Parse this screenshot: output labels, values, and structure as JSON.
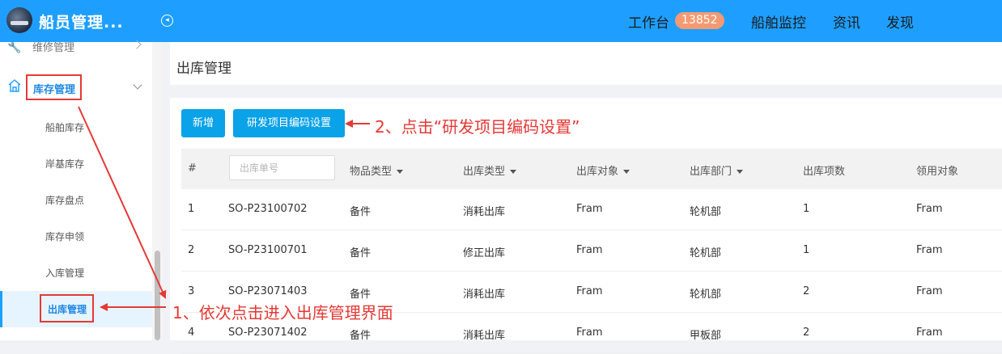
{
  "header": {
    "app_title": "船员管理...",
    "nav": {
      "workbench": "工作台",
      "workbench_badge": "13852",
      "ship_monitor": "船舶监控",
      "news": "资讯",
      "discover": "发现"
    },
    "colors": {
      "header_bg": "#1e9fff",
      "badge_bg": "#f49a72"
    }
  },
  "sidebar": {
    "items": [
      {
        "label": "维修管理",
        "icon": "wrench-icon"
      },
      {
        "label": "库存管理",
        "icon": "home-icon",
        "expanded": true
      }
    ],
    "subitems": [
      {
        "label": "船舶库存"
      },
      {
        "label": "岸基库存"
      },
      {
        "label": "库存盘点"
      },
      {
        "label": "库存申领"
      },
      {
        "label": "入库管理"
      },
      {
        "label": "出库管理",
        "active": true
      }
    ]
  },
  "page": {
    "title": "出库管理"
  },
  "toolbar": {
    "add_label": "新增",
    "rd_code_label": "研发项目编码设置"
  },
  "annotations": {
    "step2": "2、点击“研发项目编码设置”",
    "step1": "1、依次点击进入出库管理界面",
    "color": "#e53935"
  },
  "table": {
    "search_placeholder": "出库单号",
    "headers": {
      "index": "#",
      "item_type": "物品类型",
      "out_type": "出库类型",
      "out_target": "出库对象",
      "out_dept": "出库部门",
      "out_count": "出库项数",
      "recipient": "领用对象"
    },
    "rows": [
      {
        "no": "1",
        "order": "SO-P23100702",
        "item_type": "备件",
        "out_type": "消耗出库",
        "target": "Fram",
        "dept": "轮机部",
        "count": "1",
        "recipient": "Fram"
      },
      {
        "no": "2",
        "order": "SO-P23100701",
        "item_type": "备件",
        "out_type": "修正出库",
        "target": "Fram",
        "dept": "轮机部",
        "count": "1",
        "recipient": "Fram"
      },
      {
        "no": "3",
        "order": "SO-P23071403",
        "item_type": "备件",
        "out_type": "消耗出库",
        "target": "Fram",
        "dept": "轮机部",
        "count": "2",
        "recipient": "Fram"
      },
      {
        "no": "4",
        "order": "SO-P23071402",
        "item_type": "备件",
        "out_type": "消耗出库",
        "target": "Fram",
        "dept": "甲板部",
        "count": "2",
        "recipient": "Fram"
      }
    ]
  }
}
